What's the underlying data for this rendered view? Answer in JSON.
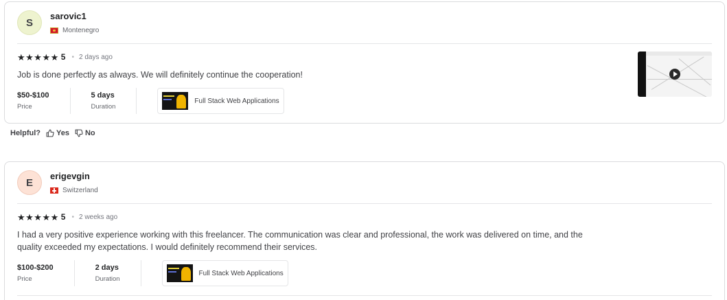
{
  "reviews": [
    {
      "avatar_initial": "S",
      "username": "sarovic1",
      "country": "Montenegro",
      "stars": "★★★★★",
      "rating": "5",
      "time_ago": "2 days ago",
      "text": "Job is done perfectly as always. We will definitely continue the cooperation!",
      "price_value": "$50-$100",
      "price_label": "Price",
      "duration_value": "5 days",
      "duration_label": "Duration",
      "gig_title": "Full Stack Web Applications",
      "has_video": true
    },
    {
      "avatar_initial": "E",
      "username": "erigevgin",
      "country": "Switzerland",
      "stars": "★★★★★",
      "rating": "5",
      "time_ago": "2 weeks ago",
      "text": "I had a very positive experience working with this freelancer. The communication was clear and professional, the work was delivered on time, and the quality exceeded my expectations. I would definitely recommend their services.",
      "price_value": "$100-$200",
      "price_label": "Price",
      "duration_value": "2 days",
      "duration_label": "Duration",
      "gig_title": "Full Stack Web Applications",
      "has_video": false
    }
  ],
  "helpful": {
    "label": "Helpful?",
    "yes": "Yes",
    "no": "No"
  },
  "icons": {
    "thumbs_up": "thumbs-up-icon",
    "thumbs_down": "thumbs-down-icon",
    "play": "play-icon"
  },
  "colors": {
    "text_primary": "#222325",
    "text_secondary": "#62646a",
    "border": "#dadbdd",
    "avatar1_bg": "#eef3cf",
    "avatar2_bg": "#fde2d6"
  }
}
